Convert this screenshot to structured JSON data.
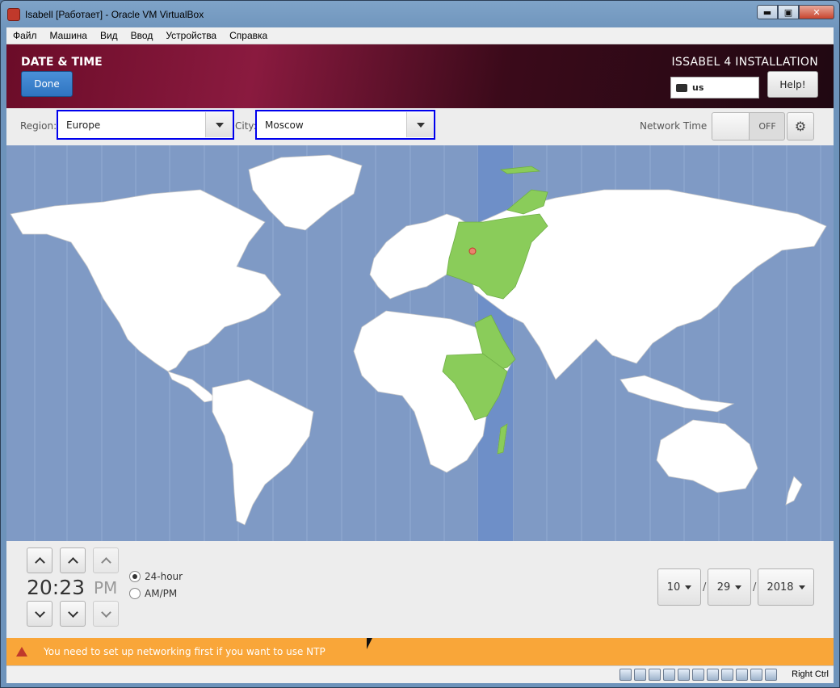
{
  "window": {
    "title": "Isabell [Работает] - Oracle VM VirtualBox",
    "min_label": "▬",
    "max_label": "▣",
    "close_label": "✕"
  },
  "menu": [
    "Файл",
    "Машина",
    "Вид",
    "Ввод",
    "Устройства",
    "Справка"
  ],
  "header": {
    "page_title": "DATE & TIME",
    "done_label": "Done",
    "install_title": "ISSABEL 4 INSTALLATION",
    "keyboard_layout": "us",
    "help_label": "Help!"
  },
  "toolbar": {
    "region_label": "Region:",
    "region_value": "Europe",
    "city_label": "City:",
    "city_value": "Moscow",
    "network_time_label": "Network Time",
    "network_time_state": "OFF"
  },
  "time": {
    "value": "20:23",
    "ampm": "PM",
    "format_24": "24-hour",
    "format_ampm": "AM/PM",
    "selected_format": "24-hour"
  },
  "date": {
    "month": "10",
    "day": "29",
    "year": "2018",
    "separator": "/"
  },
  "warning": {
    "text": "You need to set up networking first if you want to use NTP"
  },
  "statusbar": {
    "host_key": "Right Ctrl"
  },
  "colors": {
    "header_accent": "#6b0c28",
    "done_button": "#3b82d0",
    "highlight_zone": "#6e8fc8",
    "selected_land": "#8acc5a",
    "warning_bar": "#f9a639",
    "ocean": "#7f9ac5"
  }
}
